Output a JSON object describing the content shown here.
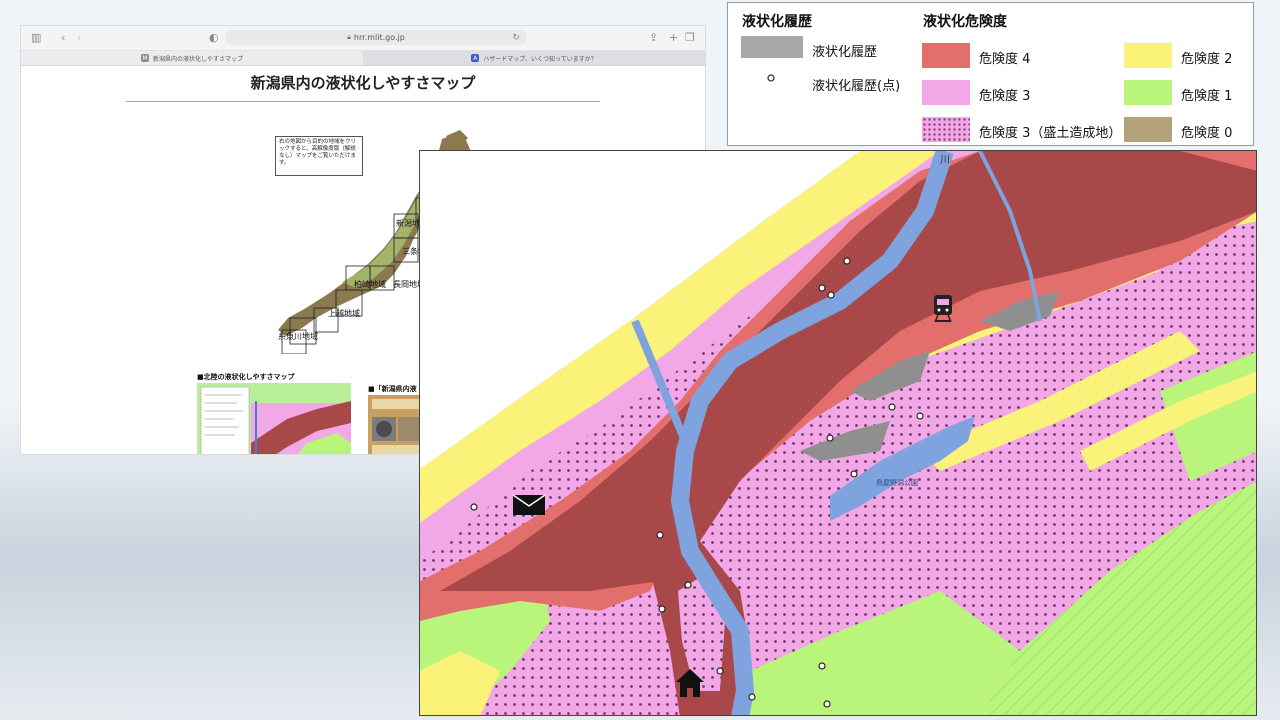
{
  "browser": {
    "address": "hrr.mlit.go.jp",
    "tabs": [
      {
        "label": "新潟県内の液状化しやすさマップ",
        "favicon": "M",
        "active": true
      },
      {
        "label": "ハザードマップ、いくつ知っていますか？",
        "favicon": "A",
        "active": false
      }
    ],
    "page": {
      "title": "新潟県内の液状化しやすさマップ",
      "instruction": "右の地図から目的の地域をクリックすると、高解像度版（解説なし）マップをご覧いただけます。",
      "regions": [
        "新潟地域",
        "三条地域",
        "柏崎地域",
        "長岡地域",
        "上越地域",
        "糸魚川地域"
      ],
      "thumbs": [
        {
          "title": "■北陸の液状化しやすさマップ"
        },
        {
          "title": "■「新潟県内液"
        }
      ]
    }
  },
  "legend": {
    "history_title": "液状化履歴",
    "history_items": [
      {
        "label": "液状化履歴",
        "color": "#a8a8a8"
      },
      {
        "label": "液状化履歴(点)",
        "icon": "circle-marker-icon"
      }
    ],
    "risk_title": "液状化危険度",
    "risk_items": [
      {
        "label": "危険度 4",
        "color": "#e36f6c"
      },
      {
        "label": "危険度 3",
        "color": "#f2a8e6"
      },
      {
        "label": "危険度 3（盛土造成地）",
        "color": "#f2a8e6",
        "pattern": "dots"
      },
      {
        "label": "危険度 2",
        "color": "#fbf27a"
      },
      {
        "label": "危険度 1",
        "color": "#b8f57a"
      },
      {
        "label": "危険度 0",
        "color": "#b3a27c"
      }
    ]
  },
  "map": {
    "labels": {
      "river": "川",
      "park": "鳥屋野潟公園"
    },
    "icons": [
      "train-icon",
      "mail-icon",
      "home-icon"
    ],
    "colors": {
      "river": "#7ea3df",
      "history": "#8f8f8f",
      "risk4": "#e36f6c",
      "risk4_dark": "#a94848",
      "risk3": "#f2a8e6",
      "risk2": "#fbf27a",
      "risk1": "#b8f57a"
    }
  }
}
